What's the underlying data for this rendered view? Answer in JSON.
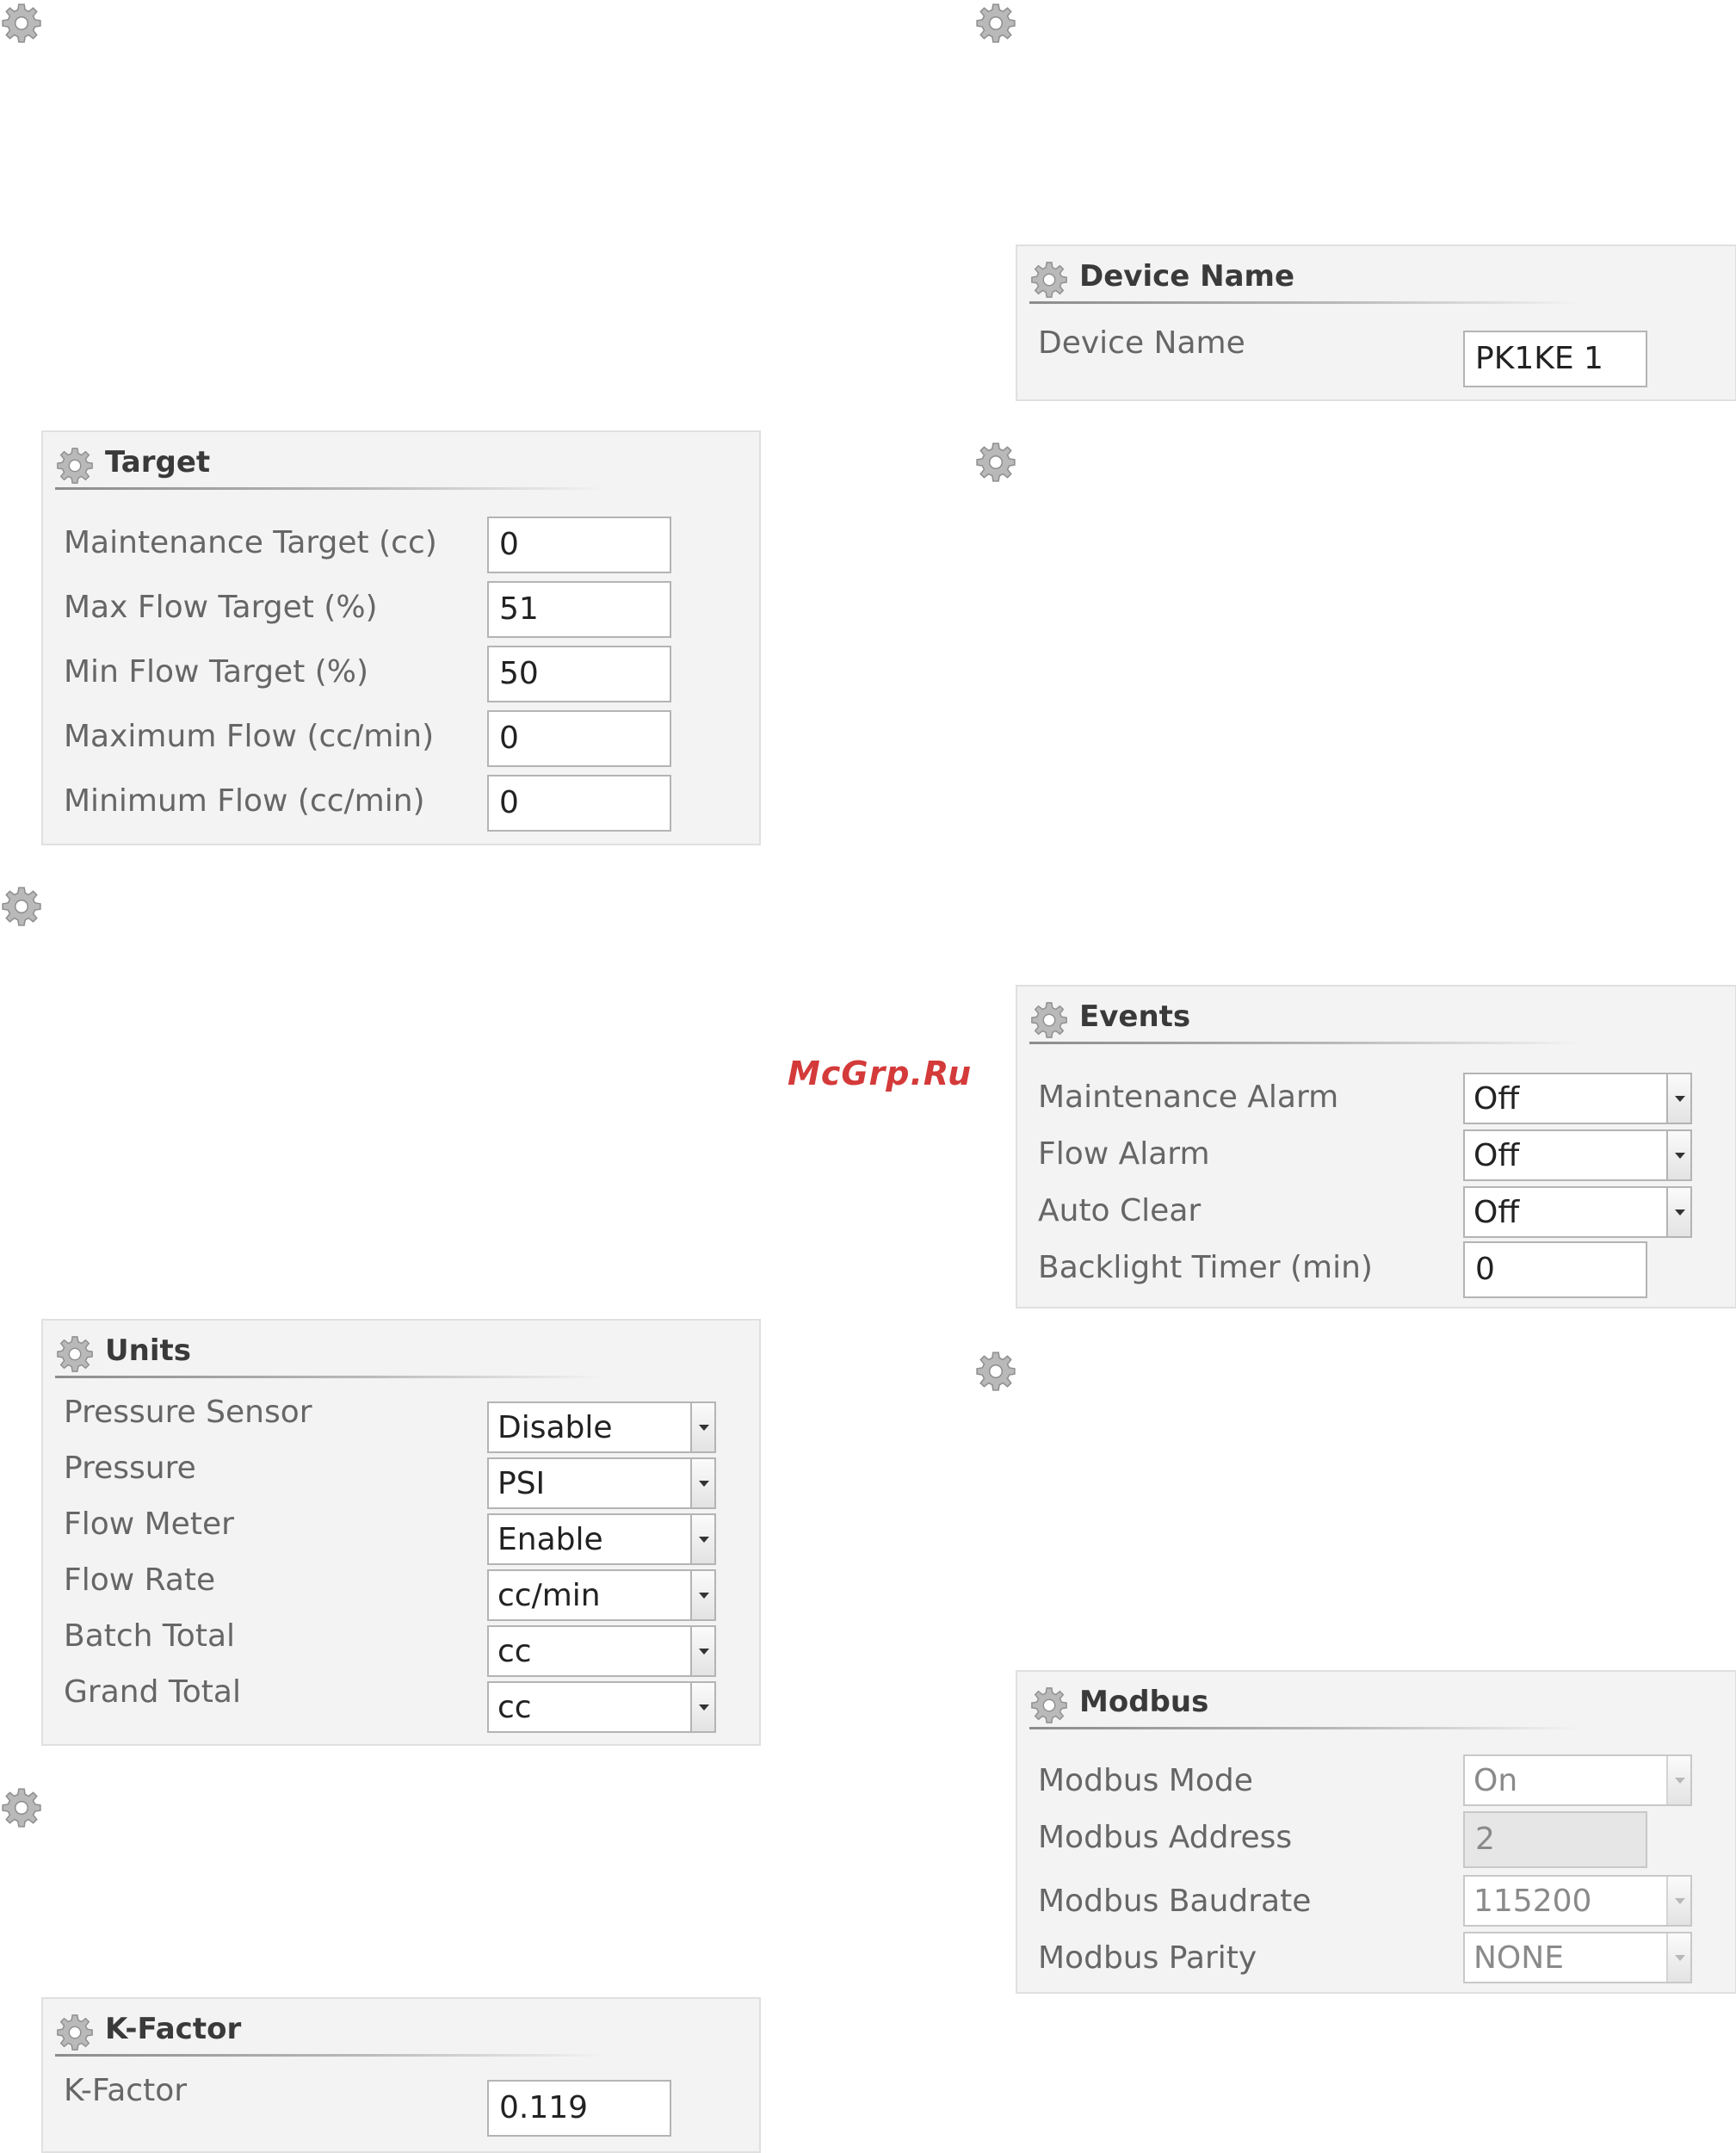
{
  "watermark": "McGrp.Ru",
  "target": {
    "title": "Target",
    "rows": [
      {
        "label": "Maintenance Target (cc)",
        "value": "0"
      },
      {
        "label": "Max Flow Target (%)",
        "value": "51"
      },
      {
        "label": "Min Flow Target (%)",
        "value": "50"
      },
      {
        "label": "Maximum Flow (cc/min)",
        "value": "0"
      },
      {
        "label": "Minimum Flow (cc/min)",
        "value": "0"
      }
    ]
  },
  "units": {
    "title": "Units",
    "rows": [
      {
        "label": "Pressure Sensor",
        "value": "Disable"
      },
      {
        "label": "Pressure",
        "value": "PSI"
      },
      {
        "label": "Flow Meter",
        "value": "Enable"
      },
      {
        "label": "Flow Rate",
        "value": "cc/min"
      },
      {
        "label": "Batch Total",
        "value": "cc"
      },
      {
        "label": "Grand Total",
        "value": "cc"
      }
    ]
  },
  "kfactor": {
    "title": "K-Factor",
    "label": "K-Factor",
    "value": "0.119"
  },
  "device": {
    "title": "Device Name",
    "label": "Device Name",
    "value": "PK1KE 1"
  },
  "events": {
    "title": "Events",
    "rows": [
      {
        "label": "Maintenance Alarm",
        "value": "Off"
      },
      {
        "label": "Flow Alarm",
        "value": "Off"
      },
      {
        "label": "Auto Clear",
        "value": "Off"
      },
      {
        "label": "Backlight Timer (min)",
        "value": "0"
      }
    ]
  },
  "modbus": {
    "title": "Modbus",
    "rows": [
      {
        "label": "Modbus Mode",
        "value": "On"
      },
      {
        "label": "Modbus Address",
        "value": "2"
      },
      {
        "label": "Modbus Baudrate",
        "value": "115200"
      },
      {
        "label": "Modbus Parity",
        "value": "NONE"
      }
    ]
  }
}
